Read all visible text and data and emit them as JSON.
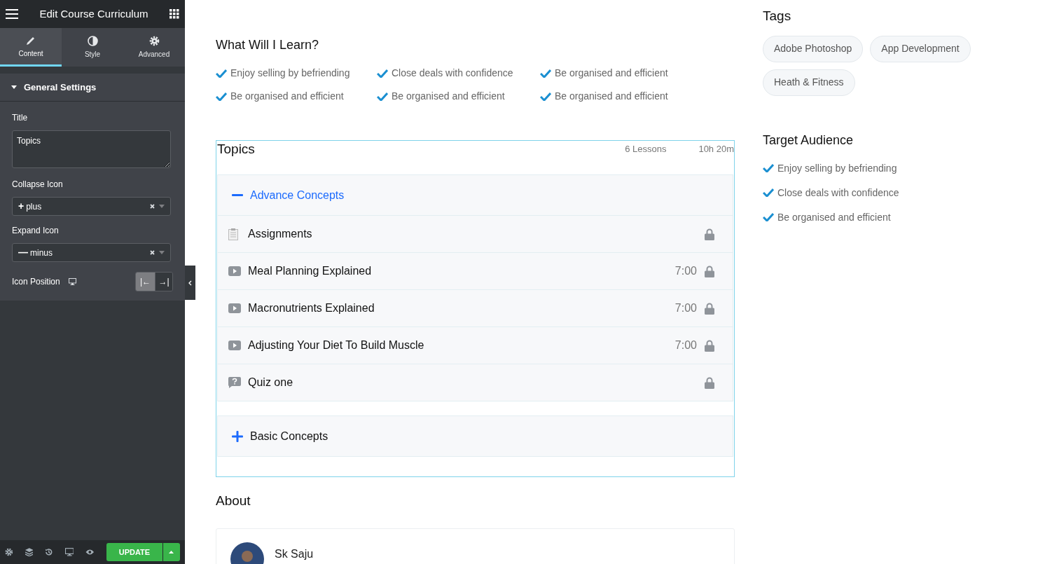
{
  "editor": {
    "title": "Edit Course Curriculum",
    "tabs": [
      {
        "label": "Content",
        "selected": true
      },
      {
        "label": "Style",
        "selected": false
      },
      {
        "label": "Advanced",
        "selected": false
      }
    ],
    "section": {
      "label": "General Settings",
      "expanded": true
    },
    "title_field": {
      "label": "Title",
      "value": "Topics"
    },
    "collapse_icon": {
      "label": "Collapse Icon",
      "symbol": "+",
      "value": "plus"
    },
    "expand_icon": {
      "label": "Expand Icon",
      "symbol": "—",
      "value": "minus"
    },
    "icon_position": {
      "label": "Icon Position",
      "options": [
        {
          "symbol": "|←",
          "selected": true
        },
        {
          "symbol": "→|",
          "selected": false
        }
      ]
    },
    "update_button": "UPDATE"
  },
  "learn": {
    "heading": "What Will I Learn?",
    "items": [
      "Enjoy selling by befriending",
      "Close deals with confidence",
      "Be organised and efficient",
      "Be organised and efficient",
      "Be organised and efficient",
      "Be organised and efficient"
    ]
  },
  "topics": {
    "title": "Topics",
    "lessons": "6 Lessons",
    "duration": "10h 20m",
    "sections": [
      {
        "title": "Advance Concepts",
        "expanded": true,
        "lessons": [
          {
            "kind": "assignment",
            "title": "Assignments",
            "locked": true
          },
          {
            "kind": "video",
            "title": "Meal Planning Explained",
            "time": "7:00",
            "locked": true
          },
          {
            "kind": "video",
            "title": "Macronutrients Explained",
            "time": "7:00",
            "locked": true
          },
          {
            "kind": "video",
            "title": "Adjusting Your Diet To Build Muscle",
            "time": "7:00",
            "locked": true
          },
          {
            "kind": "quiz",
            "title": "Quiz one",
            "locked": true
          }
        ]
      },
      {
        "title": "Basic Concepts",
        "expanded": false
      }
    ]
  },
  "about": {
    "heading": "About",
    "author": "Sk Saju"
  },
  "tags": {
    "heading": "Tags",
    "items": [
      "Adobe Photoshop",
      "App Development",
      "Heath & Fitness"
    ]
  },
  "audience": {
    "heading": "Target Audience",
    "items": [
      "Enjoy selling by befriending",
      "Close deals with confidence",
      "Be organised and efficient"
    ]
  }
}
